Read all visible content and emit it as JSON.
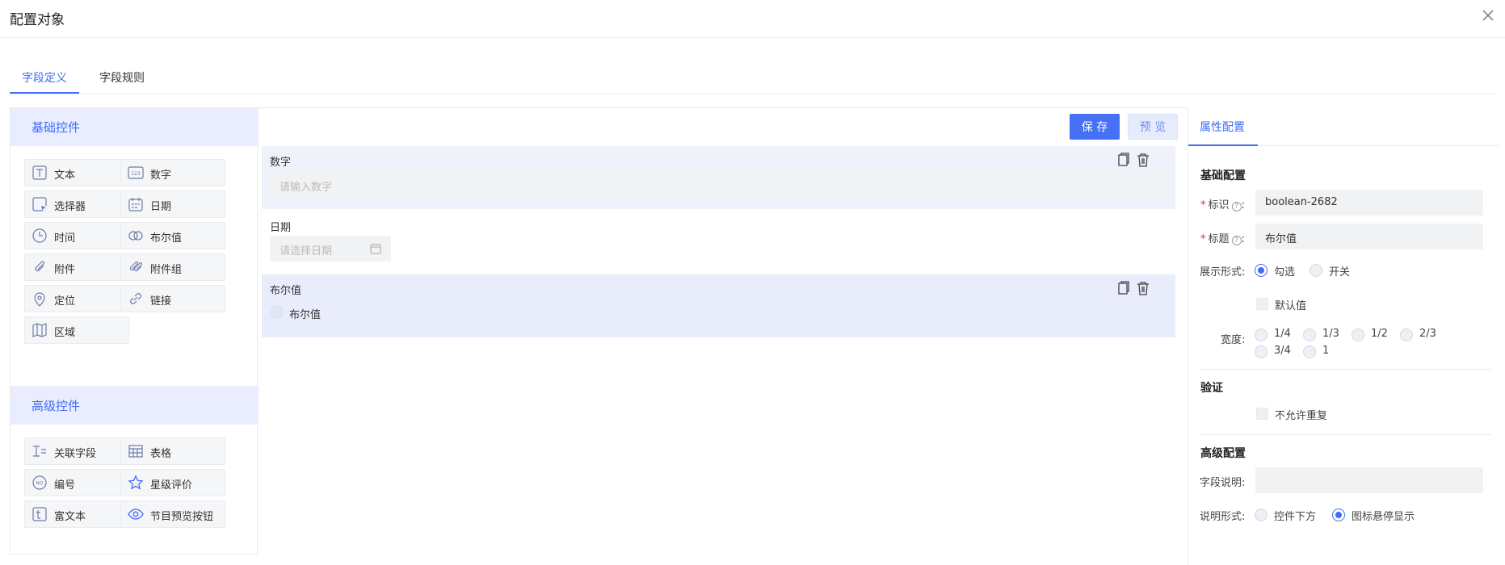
{
  "dialog": {
    "title": "配置对象"
  },
  "tabs": [
    {
      "label": "字段定义"
    },
    {
      "label": "字段规则"
    }
  ],
  "palette": {
    "basic_title": "基础控件",
    "basic": [
      {
        "label": "文本",
        "icon": "text-icon"
      },
      {
        "label": "数字",
        "icon": "number-icon"
      },
      {
        "label": "选择器",
        "icon": "selector-icon"
      },
      {
        "label": "日期",
        "icon": "calendar-icon"
      },
      {
        "label": "时间",
        "icon": "clock-icon"
      },
      {
        "label": "布尔值",
        "icon": "toggle-icon"
      },
      {
        "label": "附件",
        "icon": "paperclip-icon"
      },
      {
        "label": "附件组",
        "icon": "paperclips-icon"
      },
      {
        "label": "定位",
        "icon": "location-pin-icon"
      },
      {
        "label": "链接",
        "icon": "link-icon"
      },
      {
        "label": "区域",
        "icon": "map-icon"
      }
    ],
    "advanced_title": "高级控件",
    "advanced": [
      {
        "label": "关联字段",
        "icon": "relation-icon"
      },
      {
        "label": "表格",
        "icon": "table-icon"
      },
      {
        "label": "编号",
        "icon": "serial-number-icon"
      },
      {
        "label": "星级评价",
        "icon": "star-icon"
      },
      {
        "label": "富文本",
        "icon": "rich-text-icon"
      },
      {
        "label": "节目预览按钮",
        "icon": "eye-icon"
      }
    ]
  },
  "toolbar": {
    "save_label": "保 存",
    "preview_label": "预 览"
  },
  "canvas": {
    "fields": [
      {
        "label": "数字",
        "placeholder": "请输入数字"
      },
      {
        "label": "日期",
        "placeholder": "请选择日期"
      },
      {
        "label": "布尔值",
        "checkbox_label": "布尔值"
      }
    ]
  },
  "props": {
    "tab": "属性配置",
    "basic_title": "基础配置",
    "id_label": "标识",
    "id_value": "boolean-2682",
    "title_label": "标题",
    "title_value": "布尔值",
    "display_label": "展示形式:",
    "display_options": [
      "勾选",
      "开关"
    ],
    "default_label": "默认值",
    "width_label": "宽度:",
    "width_options": [
      "1/4",
      "1/3",
      "1/2",
      "2/3",
      "3/4",
      "1"
    ],
    "validate_title": "验证",
    "no_dup_label": "不允许重复",
    "advanced_title": "高级配置",
    "desc_label": "字段说明:",
    "desc_value": "",
    "desc_form_label": "说明形式:",
    "desc_form_options": [
      "控件下方",
      "图标悬停显示"
    ],
    "accent": "#3f6df5"
  }
}
